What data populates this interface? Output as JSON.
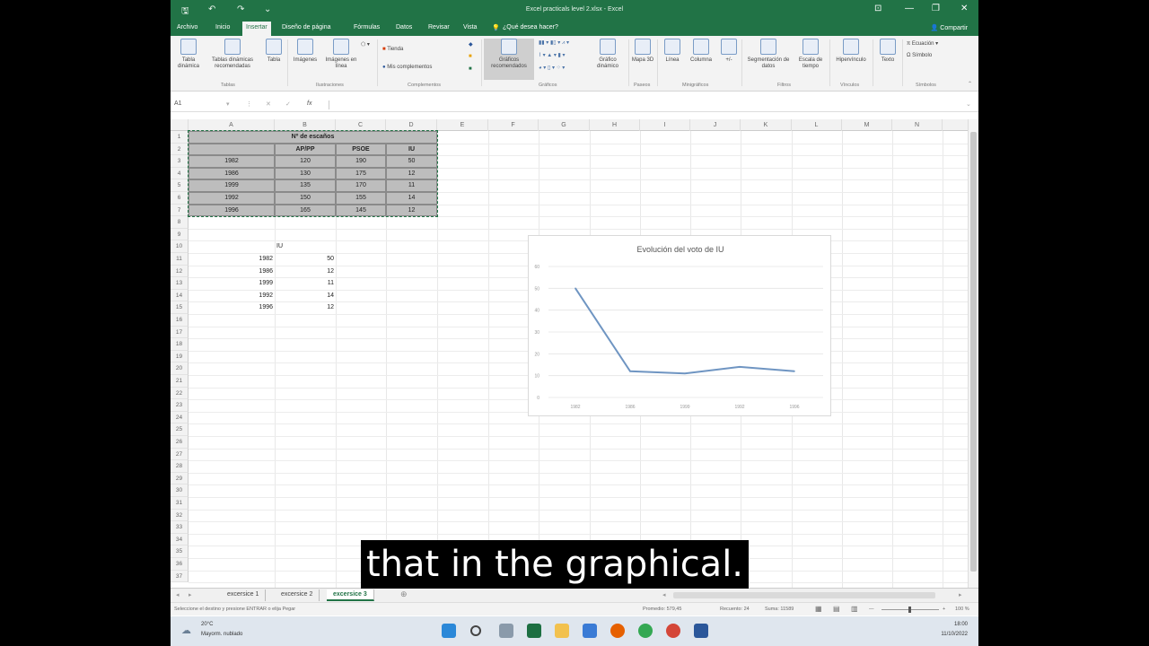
{
  "titlebar": {
    "title": "Excel practicals level 2.xlsx - Excel"
  },
  "tabs": [
    "Archivo",
    "Inicio",
    "Insertar",
    "Diseño de página",
    "Fórmulas",
    "Datos",
    "Revisar",
    "Vista"
  ],
  "active_tab": "Insertar",
  "tell_me": "¿Qué desea hacer?",
  "share": "Compartir",
  "ribbon": {
    "tablas": [
      "Tabla dinámica",
      "Tablas dinámicas recomendadas",
      "Tabla"
    ],
    "ilustraciones": [
      "Imágenes",
      "Imágenes en línea"
    ],
    "complementos": [
      "Tienda",
      "Mis complementos"
    ],
    "graficos_recomendados": "Gráficos recomendados",
    "grafico_dinamico": "Gráfico dinámico",
    "mapa3d": "Mapa 3D",
    "minigraficos": [
      "Línea",
      "Columna",
      "+/-"
    ],
    "filtros": [
      "Segmentación de datos",
      "Escala de tiempo"
    ],
    "vinculos": "Hipervínculo",
    "texto": "Texto",
    "simbolos": [
      "Ecuación",
      "Símbolo"
    ],
    "groups": [
      "Tablas",
      "Ilustraciones",
      "Complementos",
      "Gráficos",
      "Paseos",
      "Minigráficos",
      "Filtros",
      "Vínculos",
      "Símbolos"
    ]
  },
  "formula_bar": {
    "name_box": "A1",
    "content": ""
  },
  "columns": [
    "A",
    "B",
    "C",
    "D",
    "E",
    "F",
    "G",
    "H",
    "I",
    "J",
    "K",
    "L",
    "M",
    "N"
  ],
  "rows": [
    "1",
    "2",
    "3",
    "4",
    "5",
    "6",
    "7",
    "8",
    "9",
    "10",
    "11",
    "12",
    "13",
    "14",
    "15",
    "16",
    "17",
    "18",
    "19",
    "20",
    "21",
    "22",
    "23",
    "24",
    "25",
    "26",
    "27",
    "28",
    "29",
    "30",
    "31",
    "32",
    "33",
    "34",
    "35",
    "36",
    "37"
  ],
  "table": {
    "title": "Nº de escaños",
    "headers": [
      "AP/PP",
      "PSOE",
      "IU"
    ],
    "rows": [
      [
        "1982",
        "120",
        "190",
        "50"
      ],
      [
        "1986",
        "130",
        "175",
        "12"
      ],
      [
        "1999",
        "135",
        "170",
        "11"
      ],
      [
        "1992",
        "150",
        "155",
        "14"
      ],
      [
        "1996",
        "165",
        "145",
        "12"
      ]
    ]
  },
  "iu_block": {
    "header": "IU",
    "rows": [
      [
        "1982",
        "50"
      ],
      [
        "1986",
        "12"
      ],
      [
        "1999",
        "11"
      ],
      [
        "1992",
        "14"
      ],
      [
        "1996",
        "12"
      ]
    ]
  },
  "chart_data": {
    "type": "line",
    "title": "Evolución del voto de IU",
    "categories": [
      "1982",
      "1986",
      "1999",
      "1992",
      "1996"
    ],
    "series": [
      {
        "values": [
          50,
          12,
          11,
          14,
          12
        ]
      }
    ],
    "yticks": [
      "0",
      "10",
      "20",
      "30",
      "40",
      "50",
      "60"
    ],
    "ylim": [
      0,
      60
    ],
    "grid": true,
    "color": "#6f95c2"
  },
  "sheets": [
    "excersice 1",
    "excersice 2",
    "excersice 3"
  ],
  "active_sheet": "excersice 3",
  "status": {
    "left": "Seleccione el destino y presione ENTRAR o elija Pegar",
    "promedio": "Promedio: 579,45",
    "recuento": "Recuento: 24",
    "suma": "Suma: 11589",
    "zoom": "100 %"
  },
  "taskbar": {
    "weather_temp": "20°C",
    "weather_desc": "Mayorm. nublado",
    "time": "18:00",
    "date": "11/10/2022"
  },
  "subtitle": "that in the graphical."
}
